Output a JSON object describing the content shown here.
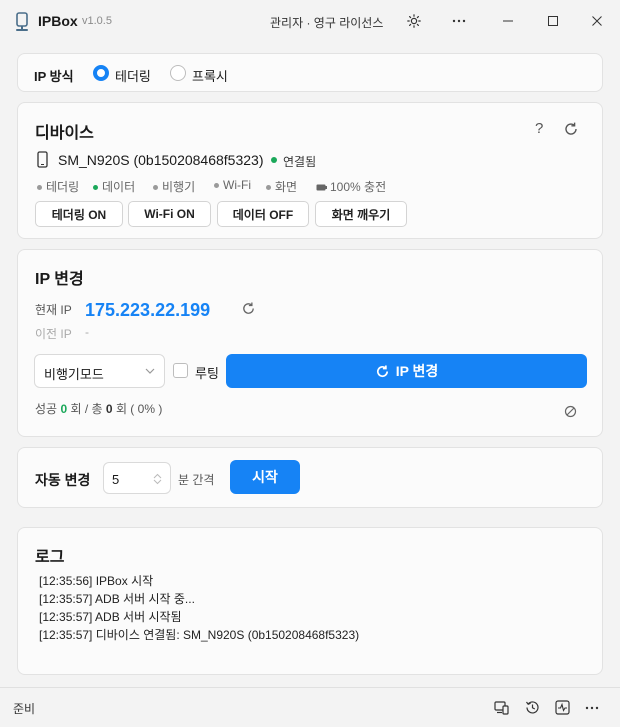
{
  "titlebar": {
    "app_name": "IPBox",
    "version": "v1.0.5",
    "license": "관리자 · 영구 라이선스"
  },
  "ip_mode": {
    "label": "IP 방식",
    "options": [
      {
        "label": "테더링",
        "selected": true
      },
      {
        "label": "프록시",
        "selected": false
      }
    ]
  },
  "device": {
    "title": "디바이스",
    "help_glyph": "?",
    "name": "SM_N920S (0b150208468f5323)",
    "connection": "연결됨",
    "status": [
      {
        "label": "테더링",
        "active": false
      },
      {
        "label": "데이터",
        "active": true
      },
      {
        "label": "비행기",
        "active": false
      },
      {
        "label": "Wi-Fi",
        "active": false
      },
      {
        "label": "화면",
        "active": false
      }
    ],
    "battery": "100% 충전",
    "buttons": [
      "테더링 ON",
      "Wi-Fi ON",
      "데이터 OFF",
      "화면 깨우기"
    ]
  },
  "ip_change": {
    "title": "IP 변경",
    "current_label": "현재 IP",
    "current_value": "175.223.22.199",
    "previous_label": "이전 IP",
    "previous_value": "-",
    "method_select": "비행기모드",
    "rooting_label": "루팅",
    "rooting_checked": false,
    "change_button": "IP 변경",
    "stats": {
      "success_label": "성공",
      "success_count": "0",
      "unit1": "회 / 총",
      "total_count": "0",
      "unit2": "회 ( 0% )"
    }
  },
  "auto_change": {
    "label": "자동 변경",
    "interval_value": "5",
    "interval_unit": "분 간격",
    "start_button": "시작"
  },
  "log": {
    "title": "로그",
    "lines": [
      "[12:35:56] IPBox 시작",
      "[12:35:57] ADB 서버 시작 중...",
      "[12:35:57] ADB 서버 시작됨",
      "[12:35:57] 디바이스 연결됨: SM_N920S (0b150208468f5323)"
    ]
  },
  "footer": {
    "status": "준비"
  },
  "colors": {
    "accent": "#1683f5",
    "connected": "#1ba85a"
  }
}
